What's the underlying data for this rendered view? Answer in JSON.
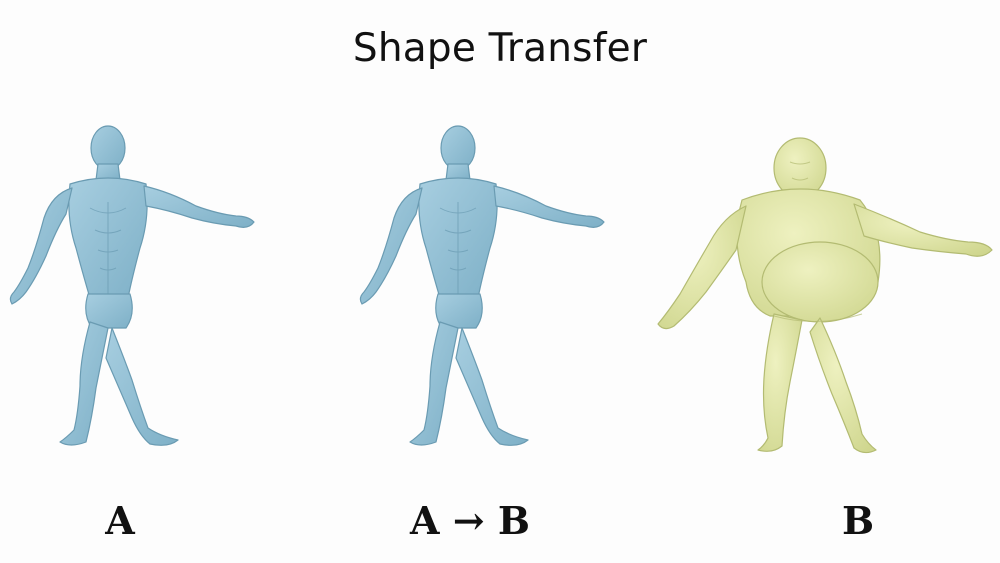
{
  "title": "Shape Transfer",
  "labels": {
    "source": "A",
    "result": "A → B",
    "target": "B"
  },
  "colors": {
    "source_mesh": "#8fbcd0",
    "source_shadow": "#6f9fb6",
    "target_mesh": "#dfe5a4",
    "target_shadow": "#b9c27a"
  },
  "figures": [
    {
      "name": "source-body",
      "description_icon": "muscular-humanoid-mesh"
    },
    {
      "name": "result-body",
      "description_icon": "muscular-humanoid-mesh"
    },
    {
      "name": "target-body",
      "description_icon": "heavy-humanoid-mesh"
    }
  ]
}
